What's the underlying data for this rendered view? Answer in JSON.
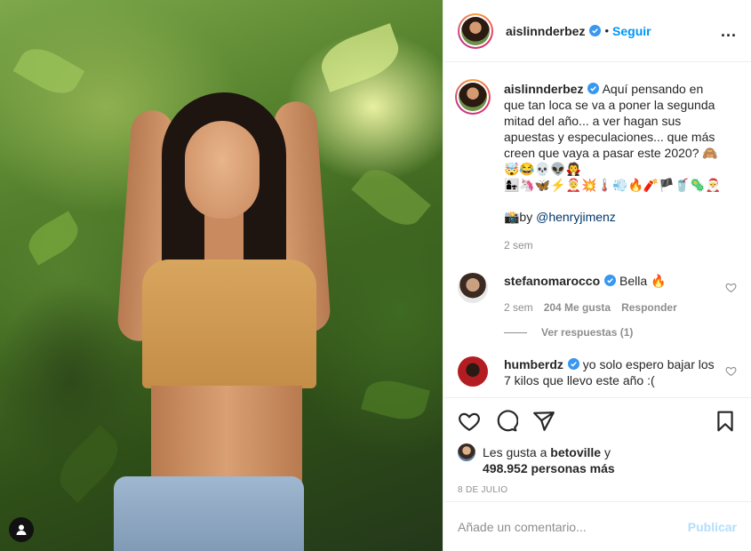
{
  "header": {
    "username": "aislinnderbez",
    "separator": "•",
    "follow_label": "Seguir",
    "more_label": "..."
  },
  "caption": {
    "username": "aislinnderbez",
    "text": "Aquí pensando en que tan loca se va a poner la segunda mitad del año... a ver hagan sus apuestas y especulaciones... que más creen que vaya a pasar este 2020? 🙈🤯😂💀👽🧛",
    "emoji_line": "👩‍👧🦄🦋⚡🤶💥🌡️💨🔥🧨🏴🥤🦠🎅",
    "credit_prefix": "📸by ",
    "credit_mention": "@henryjimenz",
    "time": "2 sem"
  },
  "comments": [
    {
      "username": "stefanomarocco",
      "text": "Bella 🔥",
      "time": "2 sem",
      "likes": "204 Me gusta",
      "reply_label": "Responder",
      "view_replies": "Ver respuestas (1)"
    },
    {
      "username": "humberdz",
      "text": "yo solo espero bajar los 7 kilos que llevo este año :("
    }
  ],
  "likes": {
    "prefix": "Les gusta a ",
    "user": "betoville",
    "joiner": " y",
    "others": "498.952 personas más"
  },
  "date": "8 DE JULIO",
  "add_comment": {
    "placeholder": "Añade un comentario...",
    "publish_label": "Publicar"
  },
  "colors": {
    "accent": "#0095f6",
    "publish_disabled": "#b2dffc",
    "muted": "#8e8e8e",
    "text": "#262626"
  },
  "icons": [
    "verified-icon",
    "more-icon",
    "heart-icon",
    "comment-icon",
    "share-icon",
    "bookmark-icon",
    "user-tag-icon"
  ]
}
